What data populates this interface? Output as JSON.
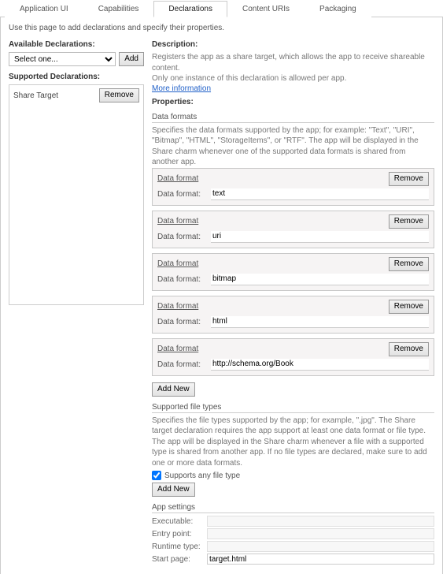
{
  "tabs": [
    "Application UI",
    "Capabilities",
    "Declarations",
    "Content URIs",
    "Packaging"
  ],
  "active_tab": 2,
  "intro": "Use this page to add declarations and specify their properties.",
  "left": {
    "available_label": "Available Declarations:",
    "select_placeholder": "Select one...",
    "add_label": "Add",
    "supported_label": "Supported Declarations:",
    "supported_item": "Share Target",
    "remove_label": "Remove"
  },
  "right": {
    "description_head": "Description:",
    "description_line1": "Registers the app as a share target, which allows the app to receive shareable content.",
    "description_line2": "Only one instance of this declaration is allowed per app.",
    "more_info": "More information",
    "properties_head": "Properties:",
    "data_formats_head": "Data formats",
    "data_formats_desc": "Specifies the data formats supported by the app; for example: \"Text\", \"URI\", \"Bitmap\", \"HTML\", \"StorageItems\", or \"RTF\". The app will be displayed in the Share charm whenever one of the supported data formats is shared from another app.",
    "df_block_title": "Data format",
    "df_field_label": "Data format:",
    "remove_label": "Remove",
    "data_formats": [
      "text",
      "uri",
      "bitmap",
      "html",
      "http://schema.org/Book"
    ],
    "add_new_label": "Add New",
    "sft_head": "Supported file types",
    "sft_desc": "Specifies the file types supported by the app; for example, \".jpg\". The Share target declaration requires the app support at least one data format or file type. The app will be displayed in the Share charm whenever a file with a supported type is shared from another app. If no file types are declared, make sure to add one or more data formats.",
    "supports_any_label": "Supports any file type",
    "supports_any_checked": true,
    "app_settings_head": "App settings",
    "executable_label": "Executable:",
    "entry_label": "Entry point:",
    "runtime_label": "Runtime type:",
    "startpage_label": "Start page:",
    "executable_val": "",
    "entry_val": "",
    "runtime_val": "",
    "startpage_val": "target.html"
  }
}
